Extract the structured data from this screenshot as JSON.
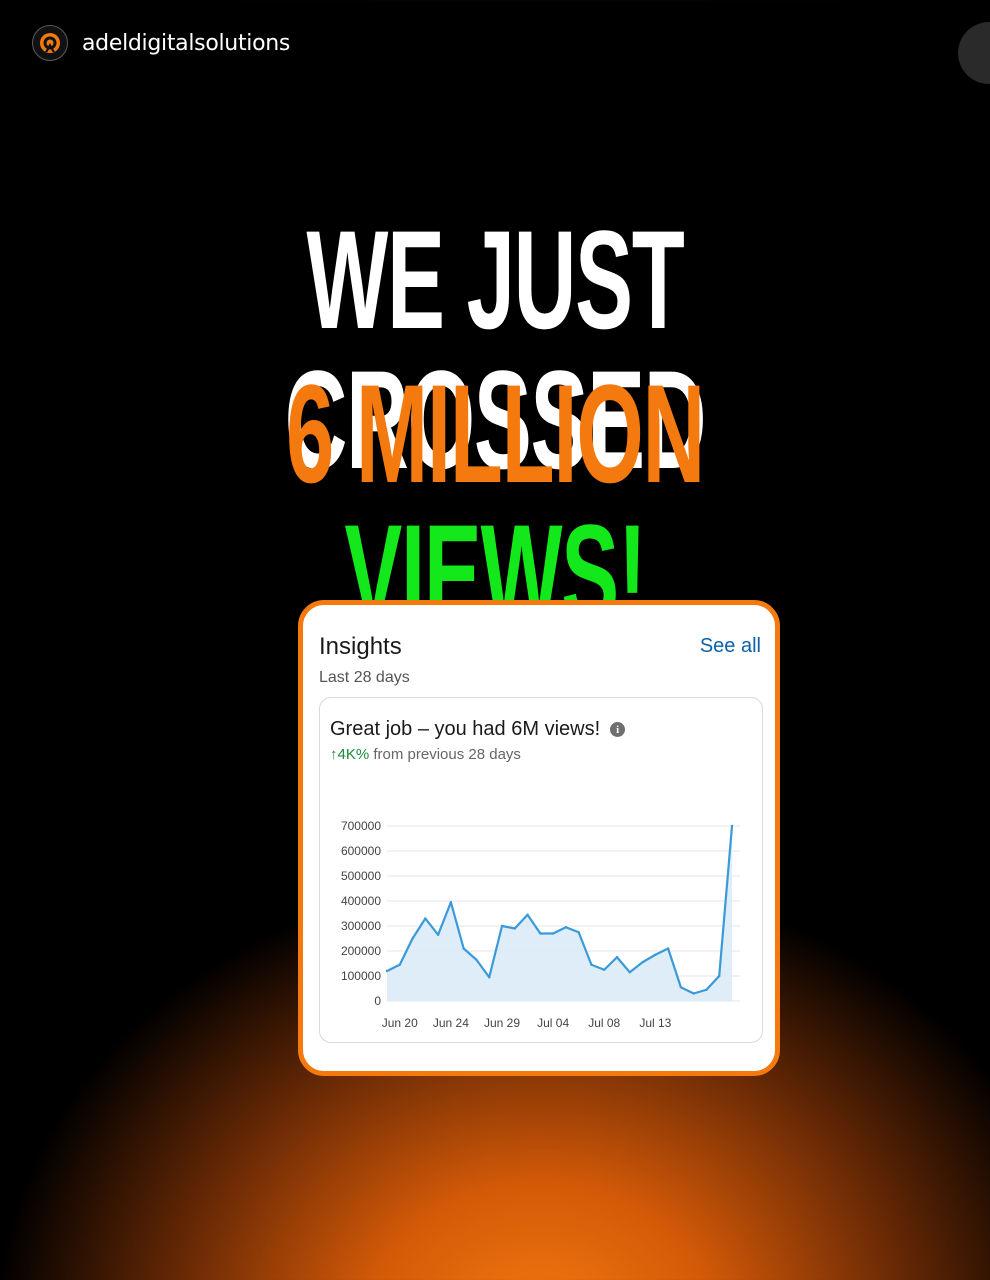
{
  "header": {
    "username": "adeldigitalsolutions",
    "avatar_icon": "target-logo-icon"
  },
  "headline": {
    "line1": "WE JUST CROSSED",
    "line2_part1": "6 MILLION",
    "line2_part2": "VIEWS!"
  },
  "colors": {
    "accent_orange": "#f47a10",
    "accent_green": "#12e81a",
    "link_blue": "#0b62a8",
    "chart_line": "#3a9ad9"
  },
  "card": {
    "title": "Insights",
    "subtitle": "Last 28 days",
    "see_all": "See all",
    "message": "Great job – you had 6M views!",
    "delta_value": "↑4K%",
    "delta_text": " from previous 28 days"
  },
  "chart_data": {
    "type": "area",
    "title": "",
    "xlabel": "",
    "ylabel": "",
    "ylim": [
      0,
      700000
    ],
    "y_ticks": [
      "0",
      "100000",
      "200000",
      "300000",
      "400000",
      "500000",
      "600000",
      "700000"
    ],
    "x_tick_labels": [
      "Jun 20",
      "Jun 24",
      "Jun 29",
      "Jul 04",
      "Jul 08",
      "Jul 13"
    ],
    "x_tick_index": [
      1,
      5,
      9,
      13,
      17,
      21
    ],
    "grid": true,
    "series": [
      {
        "values": [
          120000,
          145000,
          250000,
          330000,
          265000,
          395000,
          210000,
          165000,
          95000,
          300000,
          290000,
          345000,
          270000,
          270000,
          295000,
          275000,
          145000,
          125000,
          175000,
          115000,
          155000,
          185000,
          210000,
          55000,
          30000,
          45000,
          100000,
          700000
        ]
      }
    ]
  }
}
